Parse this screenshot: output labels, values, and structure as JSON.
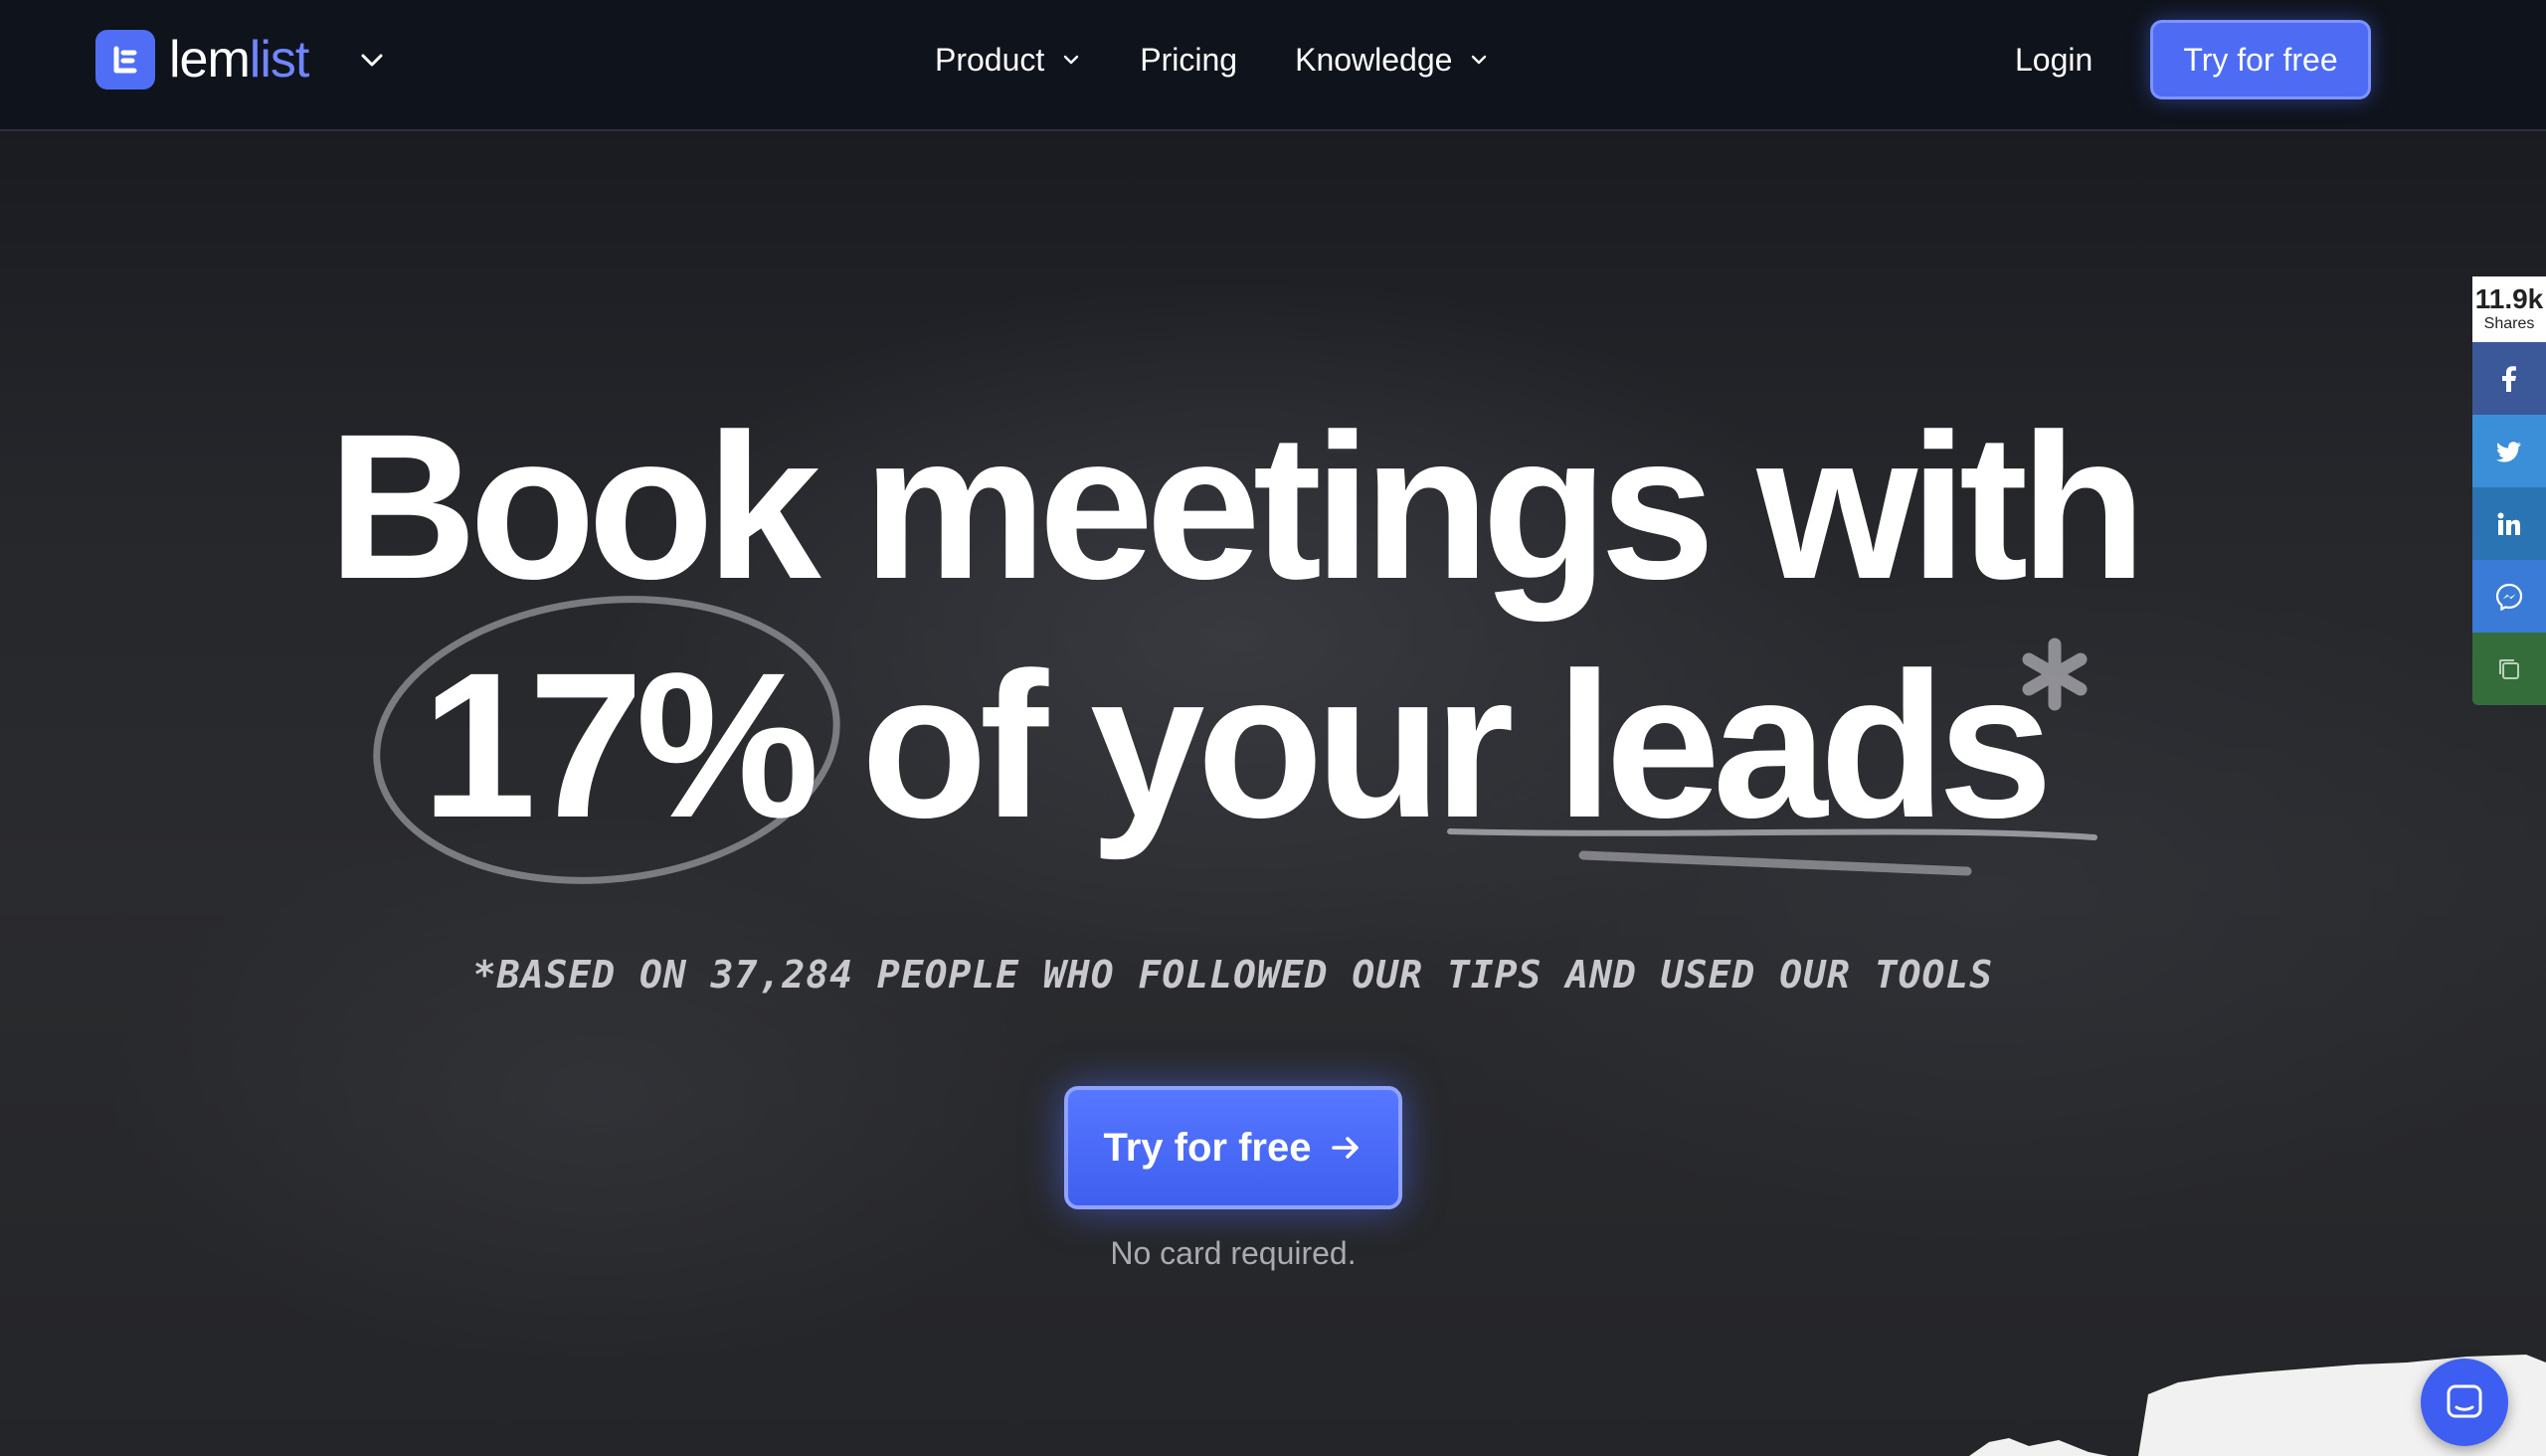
{
  "header": {
    "logo": {
      "text_part1": "lem",
      "text_part2": "list"
    },
    "nav": [
      {
        "label": "Product",
        "has_dropdown": true
      },
      {
        "label": "Pricing",
        "has_dropdown": false
      },
      {
        "label": "Knowledge",
        "has_dropdown": true
      }
    ],
    "login_label": "Login",
    "try_label": "Try for free"
  },
  "hero": {
    "headline_line1": "Book meetings with",
    "headline_line2_part1": "17%",
    "headline_line2_part2": " of your ",
    "headline_line2_part3": "leads",
    "asterisk": "*",
    "footnote": "*based on 37,284 people who followed our tips and used our tools",
    "cta_label": "Try for free",
    "no_card": "No card required."
  },
  "share_bar": {
    "count": "11.9k",
    "count_label": "Shares",
    "buttons": [
      "facebook-icon",
      "twitter-icon",
      "linkedin-icon",
      "messenger-icon",
      "copy-icon"
    ]
  },
  "colors": {
    "accent": "#4d6cf3",
    "logo_list": "#6f86ff",
    "nav_bg": "#0f131b"
  }
}
